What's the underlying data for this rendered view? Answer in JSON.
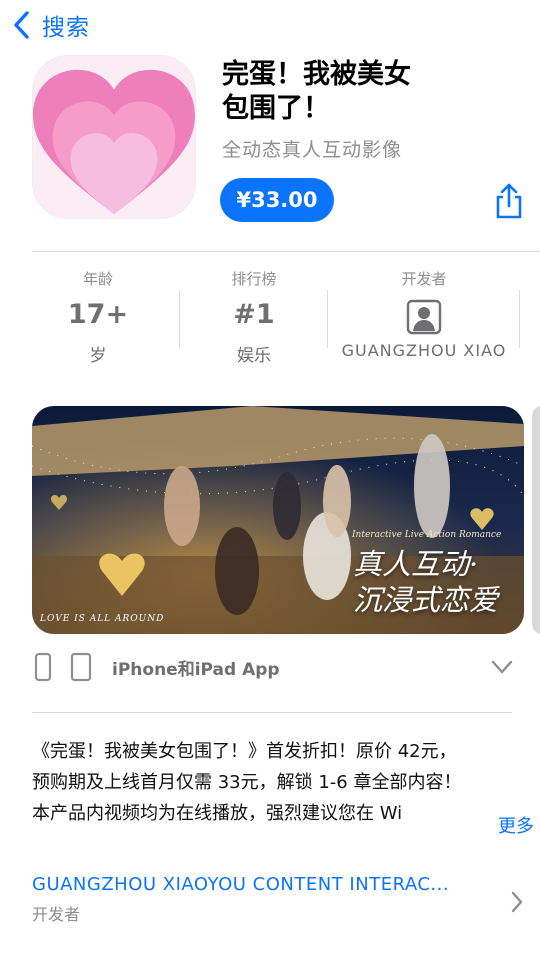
{
  "nav": {
    "back_label": "搜索"
  },
  "app": {
    "title_line1": "完蛋！我被美女",
    "title_line2": "包围了！",
    "subtitle": "全动态真人互动影像",
    "price": "¥33.00"
  },
  "info": {
    "age": {
      "label": "年龄",
      "value": "17+",
      "sub": "岁"
    },
    "chart": {
      "label": "排行榜",
      "value": "#1",
      "sub": "娱乐"
    },
    "developer": {
      "label": "开发者",
      "sub": "GUANGZHOU XIAO"
    }
  },
  "screenshot": {
    "overlay_line1": "真人互动·",
    "overlay_line2": "沉浸式恋爱",
    "caption": "LOVE IS ALL AROUND",
    "small_caption": "Interactive Live Action Romance"
  },
  "devices": {
    "label": "iPhone和iPad App"
  },
  "description": {
    "line1": "《完蛋！我被美女包围了！》首发折扣！原价 42元，",
    "line2": "预购期及上线首月仅需 33元，解锁 1-6 章全部内容！",
    "line3": "本产品内视频均为在线播放，强烈建议您在 Wi",
    "more": "更多"
  },
  "developer_row": {
    "name": "GUANGZHOU XIAOYOU CONTENT INTERAC...",
    "role": "开发者"
  },
  "colors": {
    "accent": "#0a74ff",
    "muted": "#8e8e93",
    "icon_pink": "#f08fc0"
  }
}
